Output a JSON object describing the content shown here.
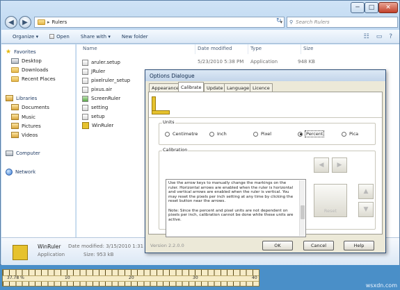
{
  "explorer": {
    "address": "Rulers",
    "search_placeholder": "Search Rulers",
    "window_buttons": {
      "minimize": "─",
      "maximize": "□",
      "close": "✕"
    },
    "toolbar": {
      "organize": "Organize ▾",
      "open": "Open",
      "share": "Share with ▾",
      "new_folder": "New folder"
    },
    "nav": {
      "favorites": "Favorites",
      "desktop": "Desktop",
      "downloads": "Downloads",
      "recent": "Recent Places",
      "libraries": "Libraries",
      "documents": "Documents",
      "music": "Music",
      "pictures": "Pictures",
      "videos": "Videos",
      "computer": "Computer",
      "network": "Network"
    },
    "columns": {
      "name": "Name",
      "date": "Date modified",
      "type": "Type",
      "size": "Size"
    },
    "files": [
      {
        "name": "aruler.setup",
        "date": "5/23/2010 5:38 PM",
        "type": "Application",
        "size": "948 KB"
      },
      {
        "name": "JRuler",
        "date": "",
        "type": "",
        "size": ""
      },
      {
        "name": "pixelruler_setup",
        "date": "",
        "type": "",
        "size": ""
      },
      {
        "name": "pixus.air",
        "date": "",
        "type": "",
        "size": ""
      },
      {
        "name": "ScreenRuler",
        "date": "",
        "type": "",
        "size": ""
      },
      {
        "name": "setting",
        "date": "",
        "type": "",
        "size": ""
      },
      {
        "name": "setup",
        "date": "",
        "type": "",
        "size": ""
      },
      {
        "name": "WinRuler",
        "date": "",
        "type": "",
        "size": ""
      }
    ],
    "details": {
      "name": "WinRuler",
      "date_label": "Date modified: 3/15/2010 1:31 PM",
      "type": "Application",
      "size_label": "Size: 953 kB"
    }
  },
  "dialog": {
    "title": "Options Dialogue",
    "tabs": [
      "Appearance",
      "Calibrate",
      "Update",
      "Language",
      "Licence"
    ],
    "units_label": "Units",
    "units": [
      "Centimetre",
      "Inch",
      "Pixel",
      "Percent",
      "Pica"
    ],
    "selected_unit": "Percent",
    "calibration_label": "Calibration",
    "calibration_text": "Use the arrow keys to manually change the markings on the ruler. Horizontal arrows are enabled when the ruler is horizontal and vertical arrows are enabled when the ruler is vertical. You may reset the pixels per inch setting at any time by clicking the reset button near the arrows.\n\nNote: Since the percent and pixel units are not dependent on pixels per inch, calibration cannot be done while these units are active.",
    "reset": "Reset",
    "version": "Version 2.2.0.0",
    "ok": "OK",
    "cancel": "Cancel",
    "help": "Help"
  },
  "ruler": {
    "readout": "37.78 %",
    "ticks": [
      "10",
      "20",
      "30",
      "40"
    ]
  },
  "watermark": "wsxdn.com"
}
